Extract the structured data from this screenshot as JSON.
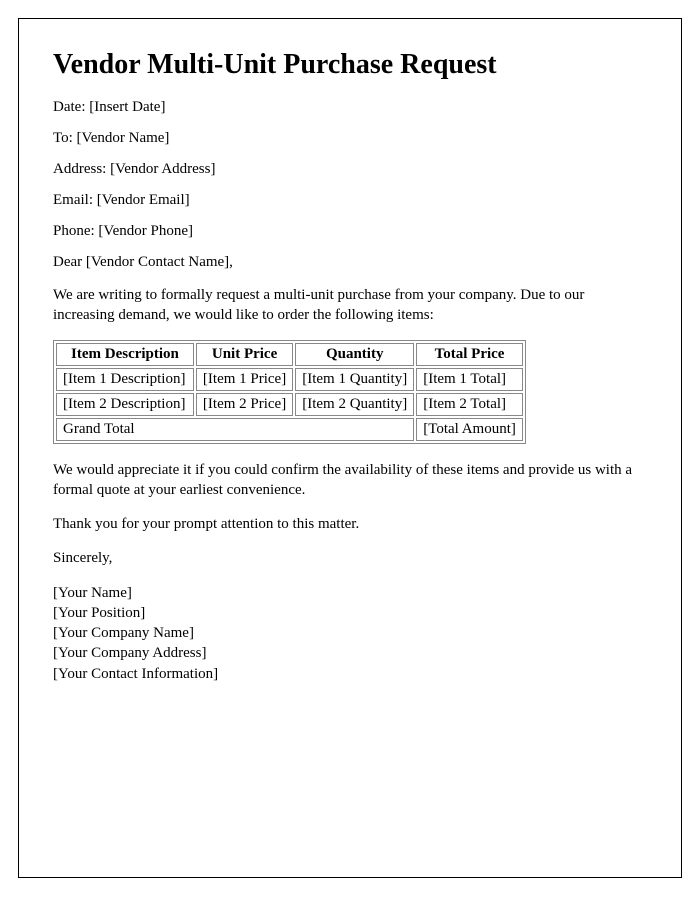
{
  "title": "Vendor Multi-Unit Purchase Request",
  "fields": {
    "date_label": "Date:",
    "date_value": "[Insert Date]",
    "to_label": "To:",
    "to_value": "[Vendor Name]",
    "address_label": "Address:",
    "address_value": "[Vendor Address]",
    "email_label": "Email:",
    "email_value": "[Vendor Email]",
    "phone_label": "Phone:",
    "phone_value": "[Vendor Phone]"
  },
  "salutation": "Dear [Vendor Contact Name],",
  "intro": "We are writing to formally request a multi-unit purchase from your company. Due to our increasing demand, we would like to order the following items:",
  "table": {
    "headers": {
      "desc": "Item Description",
      "unit": "Unit Price",
      "qty": "Quantity",
      "total": "Total Price"
    },
    "rows": [
      {
        "desc": "[Item 1 Description]",
        "unit": "[Item 1 Price]",
        "qty": "[Item 1 Quantity]",
        "total": "[Item 1 Total]"
      },
      {
        "desc": "[Item 2 Description]",
        "unit": "[Item 2 Price]",
        "qty": "[Item 2 Quantity]",
        "total": "[Item 2 Total]"
      }
    ],
    "grand_label": "Grand Total",
    "grand_total": "[Total Amount]"
  },
  "followup": "We would appreciate it if you could confirm the availability of these items and provide us with a formal quote at your earliest convenience.",
  "thanks": "Thank you for your prompt attention to this matter.",
  "closing": "Sincerely,",
  "signature": {
    "name": "[Your Name]",
    "position": "[Your Position]",
    "company": "[Your Company Name]",
    "address": "[Your Company Address]",
    "contact": "[Your Contact Information]"
  }
}
